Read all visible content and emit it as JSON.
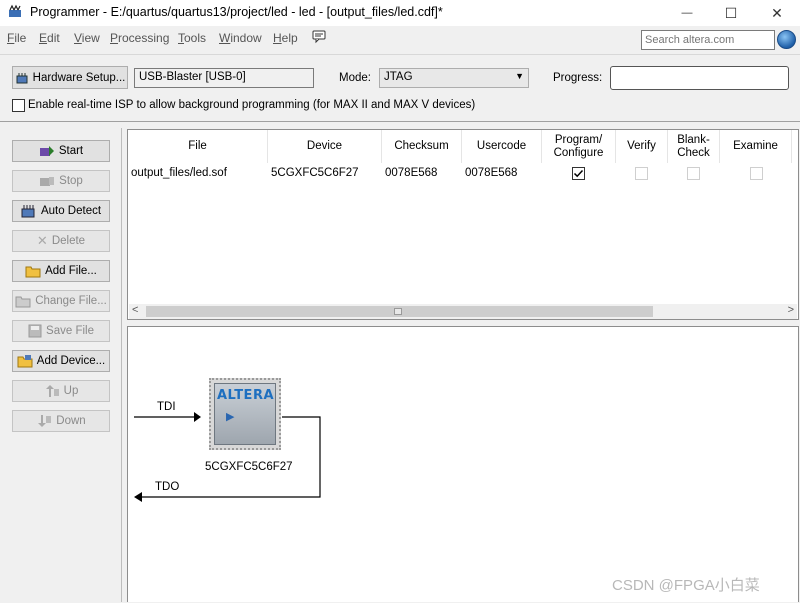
{
  "window": {
    "title": "Programmer - E:/quartus/quartus13/project/led - led - [output_files/led.cdf]*",
    "minimize": "—",
    "maximize": "☐",
    "close": "✕"
  },
  "menu": {
    "items": [
      {
        "key": "F",
        "rest": "ile"
      },
      {
        "key": "E",
        "rest": "dit"
      },
      {
        "key": "V",
        "rest": "iew"
      },
      {
        "key": "P",
        "rest": "rocessing"
      },
      {
        "key": "T",
        "rest": "ools"
      },
      {
        "key": "W",
        "rest": "indow"
      },
      {
        "key": "H",
        "rest": "elp"
      }
    ],
    "search_placeholder": "Search altera.com"
  },
  "hardware": {
    "setup_label": "Hardware Setup...",
    "device_value": "USB-Blaster [USB-0]",
    "mode_label": "Mode:",
    "mode_value": "JTAG",
    "progress_label": "Progress:",
    "isp_label": "Enable real-time ISP to allow background programming (for MAX II and MAX V devices)"
  },
  "buttons": {
    "start": "Start",
    "stop": "Stop",
    "auto_detect": "Auto Detect",
    "delete": "Delete",
    "add_file": "Add File...",
    "change_file": "Change File...",
    "save_file": "Save File",
    "add_device": "Add Device...",
    "up": "Up",
    "down": "Down"
  },
  "table": {
    "headers": {
      "file": "File",
      "device": "Device",
      "checksum": "Checksum",
      "usercode": "Usercode",
      "program_1": "Program/",
      "program_2": "Configure",
      "verify": "Verify",
      "blank_1": "Blank-",
      "blank_2": "Check",
      "examine": "Examine"
    },
    "row": {
      "file": "output_files/led.sof",
      "device": "5CGXFC5C6F27",
      "checksum": "0078E568",
      "usercode": "0078E568",
      "program_checked": true,
      "verify_checked": false,
      "blank_checked": false,
      "examine_checked": false
    },
    "scroll_left": "<",
    "scroll_right": ">"
  },
  "chain": {
    "tdi_label": "TDI",
    "tdo_label": "TDO",
    "chip_logo": "ALTERA",
    "device_label": "5CGXFC5C6F27"
  },
  "watermark": "CSDN @FPGA小白菜",
  "colors": {
    "accent": "#1e6fc0",
    "button_face": "#e1e1e1",
    "window_bg": "#f0f0f0"
  }
}
